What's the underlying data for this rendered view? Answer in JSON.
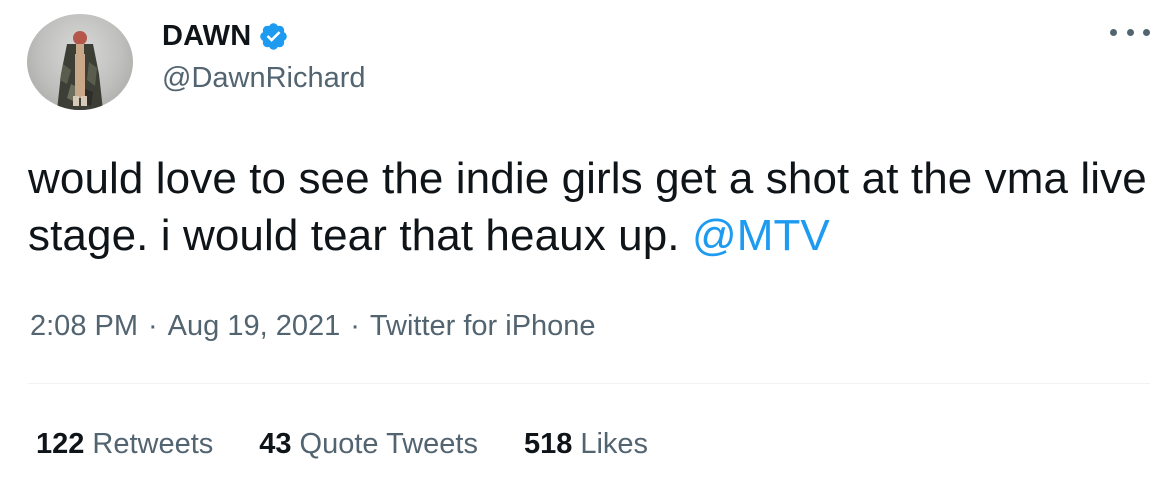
{
  "author": {
    "display_name": "DAWN",
    "handle": "@DawnRichard",
    "verified_icon": "verified-badge-icon"
  },
  "more_icon": "more-dots-icon",
  "tweet": {
    "text_part1": "would love to see the indie girls get a shot at the vma live stage. i would tear that heaux up.",
    "mention": "@MTV"
  },
  "meta": {
    "time": "2:08 PM",
    "separator": "·",
    "date": "Aug 19, 2021",
    "source": "Twitter for iPhone"
  },
  "stats": {
    "retweets_count": "122",
    "retweets_label": "Retweets",
    "quotes_count": "43",
    "quotes_label": "Quote Tweets",
    "likes_count": "518",
    "likes_label": "Likes"
  },
  "colors": {
    "link": "#1d9bf0",
    "secondary_text": "#536471",
    "primary_text": "#0f1419",
    "verified": "#1d9bf0"
  }
}
